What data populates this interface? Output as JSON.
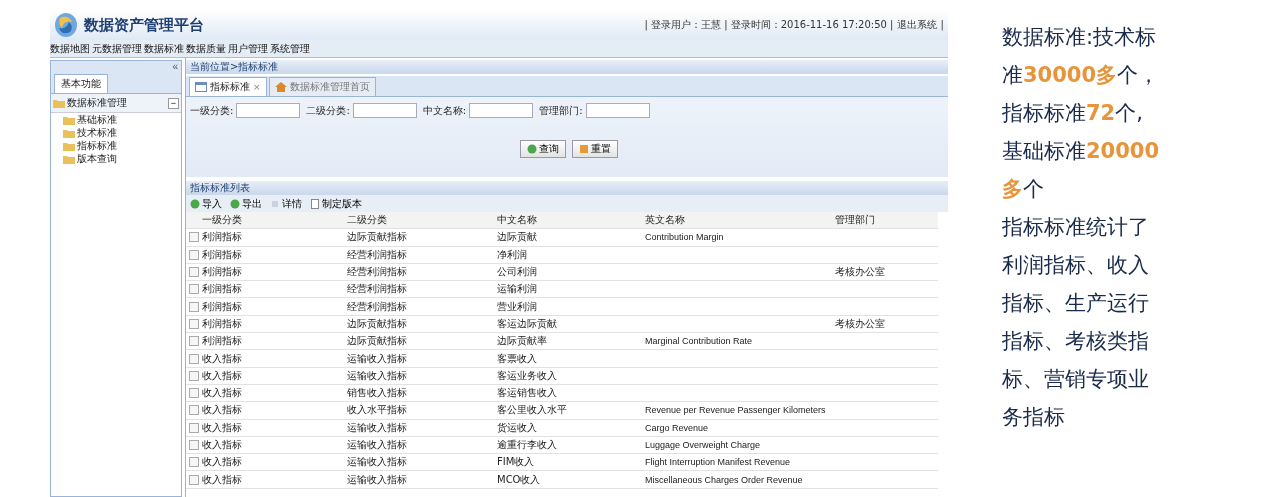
{
  "app": {
    "title": "数据资产管理平台",
    "user_info": "| 登录用户：王慧 | 登录时间：2016-11-16 17:20:50 |",
    "logout": "退出系统 |"
  },
  "menu": [
    "数据地图",
    "元数据管理",
    "数据标准",
    "数据质量",
    "用户管理",
    "系统管理"
  ],
  "sidebar": {
    "collapse": "«",
    "tab": "基本功能",
    "group": {
      "label": "数据标准管理",
      "toggle": "−",
      "expanded": true,
      "children": [
        {
          "label": "基础标准"
        },
        {
          "label": "技术标准"
        },
        {
          "label": "指标标准"
        },
        {
          "label": "版本查询"
        }
      ]
    }
  },
  "breadcrumb": "当前位置>指标标准",
  "tabs": [
    {
      "label": "指标标准",
      "close": "×",
      "selected": true
    },
    {
      "label": "数据标准管理首页",
      "selected": false
    }
  ],
  "filters": [
    {
      "label": "一级分类:"
    },
    {
      "label": "二级分类:"
    },
    {
      "label": "中文名称:"
    },
    {
      "label": "管理部门:"
    }
  ],
  "buttons": [
    "查询",
    "重置"
  ],
  "list": {
    "title": "指标标准列表",
    "toolbar": [
      {
        "label": "导入",
        "kind": "green"
      },
      {
        "label": "导出",
        "kind": "green"
      },
      {
        "label": "详情",
        "kind": "doc"
      },
      {
        "label": "制定版本",
        "kind": "page"
      }
    ],
    "columns": [
      "一级分类",
      "二级分类",
      "中文名称",
      "英文名称",
      "管理部门"
    ],
    "rows": [
      {
        "checked": false,
        "cells": [
          "利润指标",
          "边际贡献指标",
          "边际贡献",
          "Contribution Margin",
          ""
        ]
      },
      {
        "checked": false,
        "cells": [
          "利润指标",
          "经营利润指标",
          "净利润",
          "",
          ""
        ]
      },
      {
        "checked": false,
        "cells": [
          "利润指标",
          "经营利润指标",
          "公司利润",
          "",
          "考核办公室"
        ]
      },
      {
        "checked": false,
        "cells": [
          "利润指标",
          "经营利润指标",
          "运输利润",
          "",
          ""
        ]
      },
      {
        "checked": false,
        "cells": [
          "利润指标",
          "经营利润指标",
          "营业利润",
          "",
          ""
        ]
      },
      {
        "checked": false,
        "cells": [
          "利润指标",
          "边际贡献指标",
          "客运边际贡献",
          "",
          "考核办公室"
        ]
      },
      {
        "checked": false,
        "cells": [
          "利润指标",
          "边际贡献指标",
          "边际贡献率",
          "Marginal Contribution Rate",
          ""
        ]
      },
      {
        "checked": false,
        "cells": [
          "收入指标",
          "运输收入指标",
          "客票收入",
          "",
          ""
        ]
      },
      {
        "checked": false,
        "cells": [
          "收入指标",
          "运输收入指标",
          "客运业务收入",
          "",
          ""
        ]
      },
      {
        "checked": false,
        "cells": [
          "收入指标",
          "销售收入指标",
          "客运销售收入",
          "",
          ""
        ]
      },
      {
        "checked": false,
        "cells": [
          "收入指标",
          "收入水平指标",
          "客公里收入水平",
          "Revenue per Revenue Passenger Kilometers",
          ""
        ]
      },
      {
        "checked": false,
        "cells": [
          "收入指标",
          "运输收入指标",
          "货运收入",
          "Cargo Revenue",
          ""
        ]
      },
      {
        "checked": false,
        "cells": [
          "收入指标",
          "运输收入指标",
          "逾重行李收入",
          "Luggage Overweight Charge",
          ""
        ]
      },
      {
        "checked": false,
        "cells": [
          "收入指标",
          "运输收入指标",
          "FIM收入",
          "Flight Interruption Manifest Revenue",
          ""
        ]
      },
      {
        "checked": false,
        "cells": [
          "收入指标",
          "运输收入指标",
          "MCO收入",
          "Miscellaneous Charges Order Revenue",
          ""
        ]
      }
    ]
  },
  "notes": [
    "数据标准:技术标准**30000多**个，",
    "指标标准**72**个,",
    "基础标准**20000多**个",
    "指标标准统计了利润指标、收入指标、生产运行指标、考核类指标、营销专项业务指标"
  ]
}
